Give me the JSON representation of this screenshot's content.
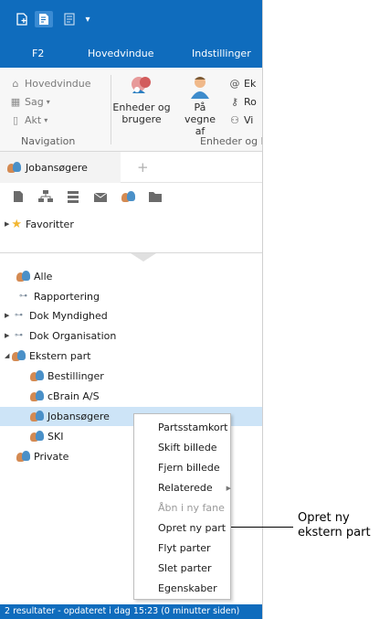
{
  "quick_access": {
    "icons": [
      "new-document-icon",
      "document-settings-icon",
      "list-icon",
      "dropdown-caret-icon"
    ]
  },
  "ribbon_tabs": [
    "F2",
    "Hovedvindue",
    "Indstillinger"
  ],
  "ribbon": {
    "navigation": {
      "items": [
        "Hovedvindue",
        "Sag",
        "Akt"
      ],
      "group_label": "Navigation"
    },
    "units": {
      "enheder_label": "Enheder og brugere",
      "paa_vegne_label": "På vegne af",
      "small_items": [
        "Ek",
        "Ro",
        "Vi"
      ],
      "group_label": "Enheder og b"
    }
  },
  "doc_tabs": {
    "active_label": "Jobansøgere",
    "add_symbol": "+"
  },
  "favorites": {
    "label": "Favoritter"
  },
  "tree": {
    "items": [
      {
        "label": "Alle"
      },
      {
        "label": "Rapportering"
      },
      {
        "label": "Dok Myndighed"
      },
      {
        "label": "Dok Organisation"
      },
      {
        "label": "Ekstern part"
      },
      {
        "label": "Bestillinger"
      },
      {
        "label": "cBrain A/S"
      },
      {
        "label": "Jobansøgere"
      },
      {
        "label": "SKI"
      },
      {
        "label": "Private"
      }
    ]
  },
  "context_menu": {
    "items": [
      {
        "label": "Partsstamkort",
        "enabled": true
      },
      {
        "label": "Skift billede",
        "enabled": true
      },
      {
        "label": "Fjern billede",
        "enabled": true
      },
      {
        "label": "Relaterede",
        "enabled": true,
        "submenu": true
      },
      {
        "label": "Åbn i ny fane",
        "enabled": false
      },
      {
        "label": "Opret ny part",
        "enabled": true
      },
      {
        "label": "Flyt parter",
        "enabled": true
      },
      {
        "label": "Slet parter",
        "enabled": true
      },
      {
        "label": "Egenskaber",
        "enabled": true
      }
    ]
  },
  "status_bar": {
    "text": "2 resultater - opdateret i dag 15:23 (0 minutter siden)"
  },
  "annotation": {
    "line1": "Opret ny",
    "line2": "ekstern part"
  },
  "colors": {
    "accent": "#0f6cbd",
    "selection": "#cde4f7"
  }
}
